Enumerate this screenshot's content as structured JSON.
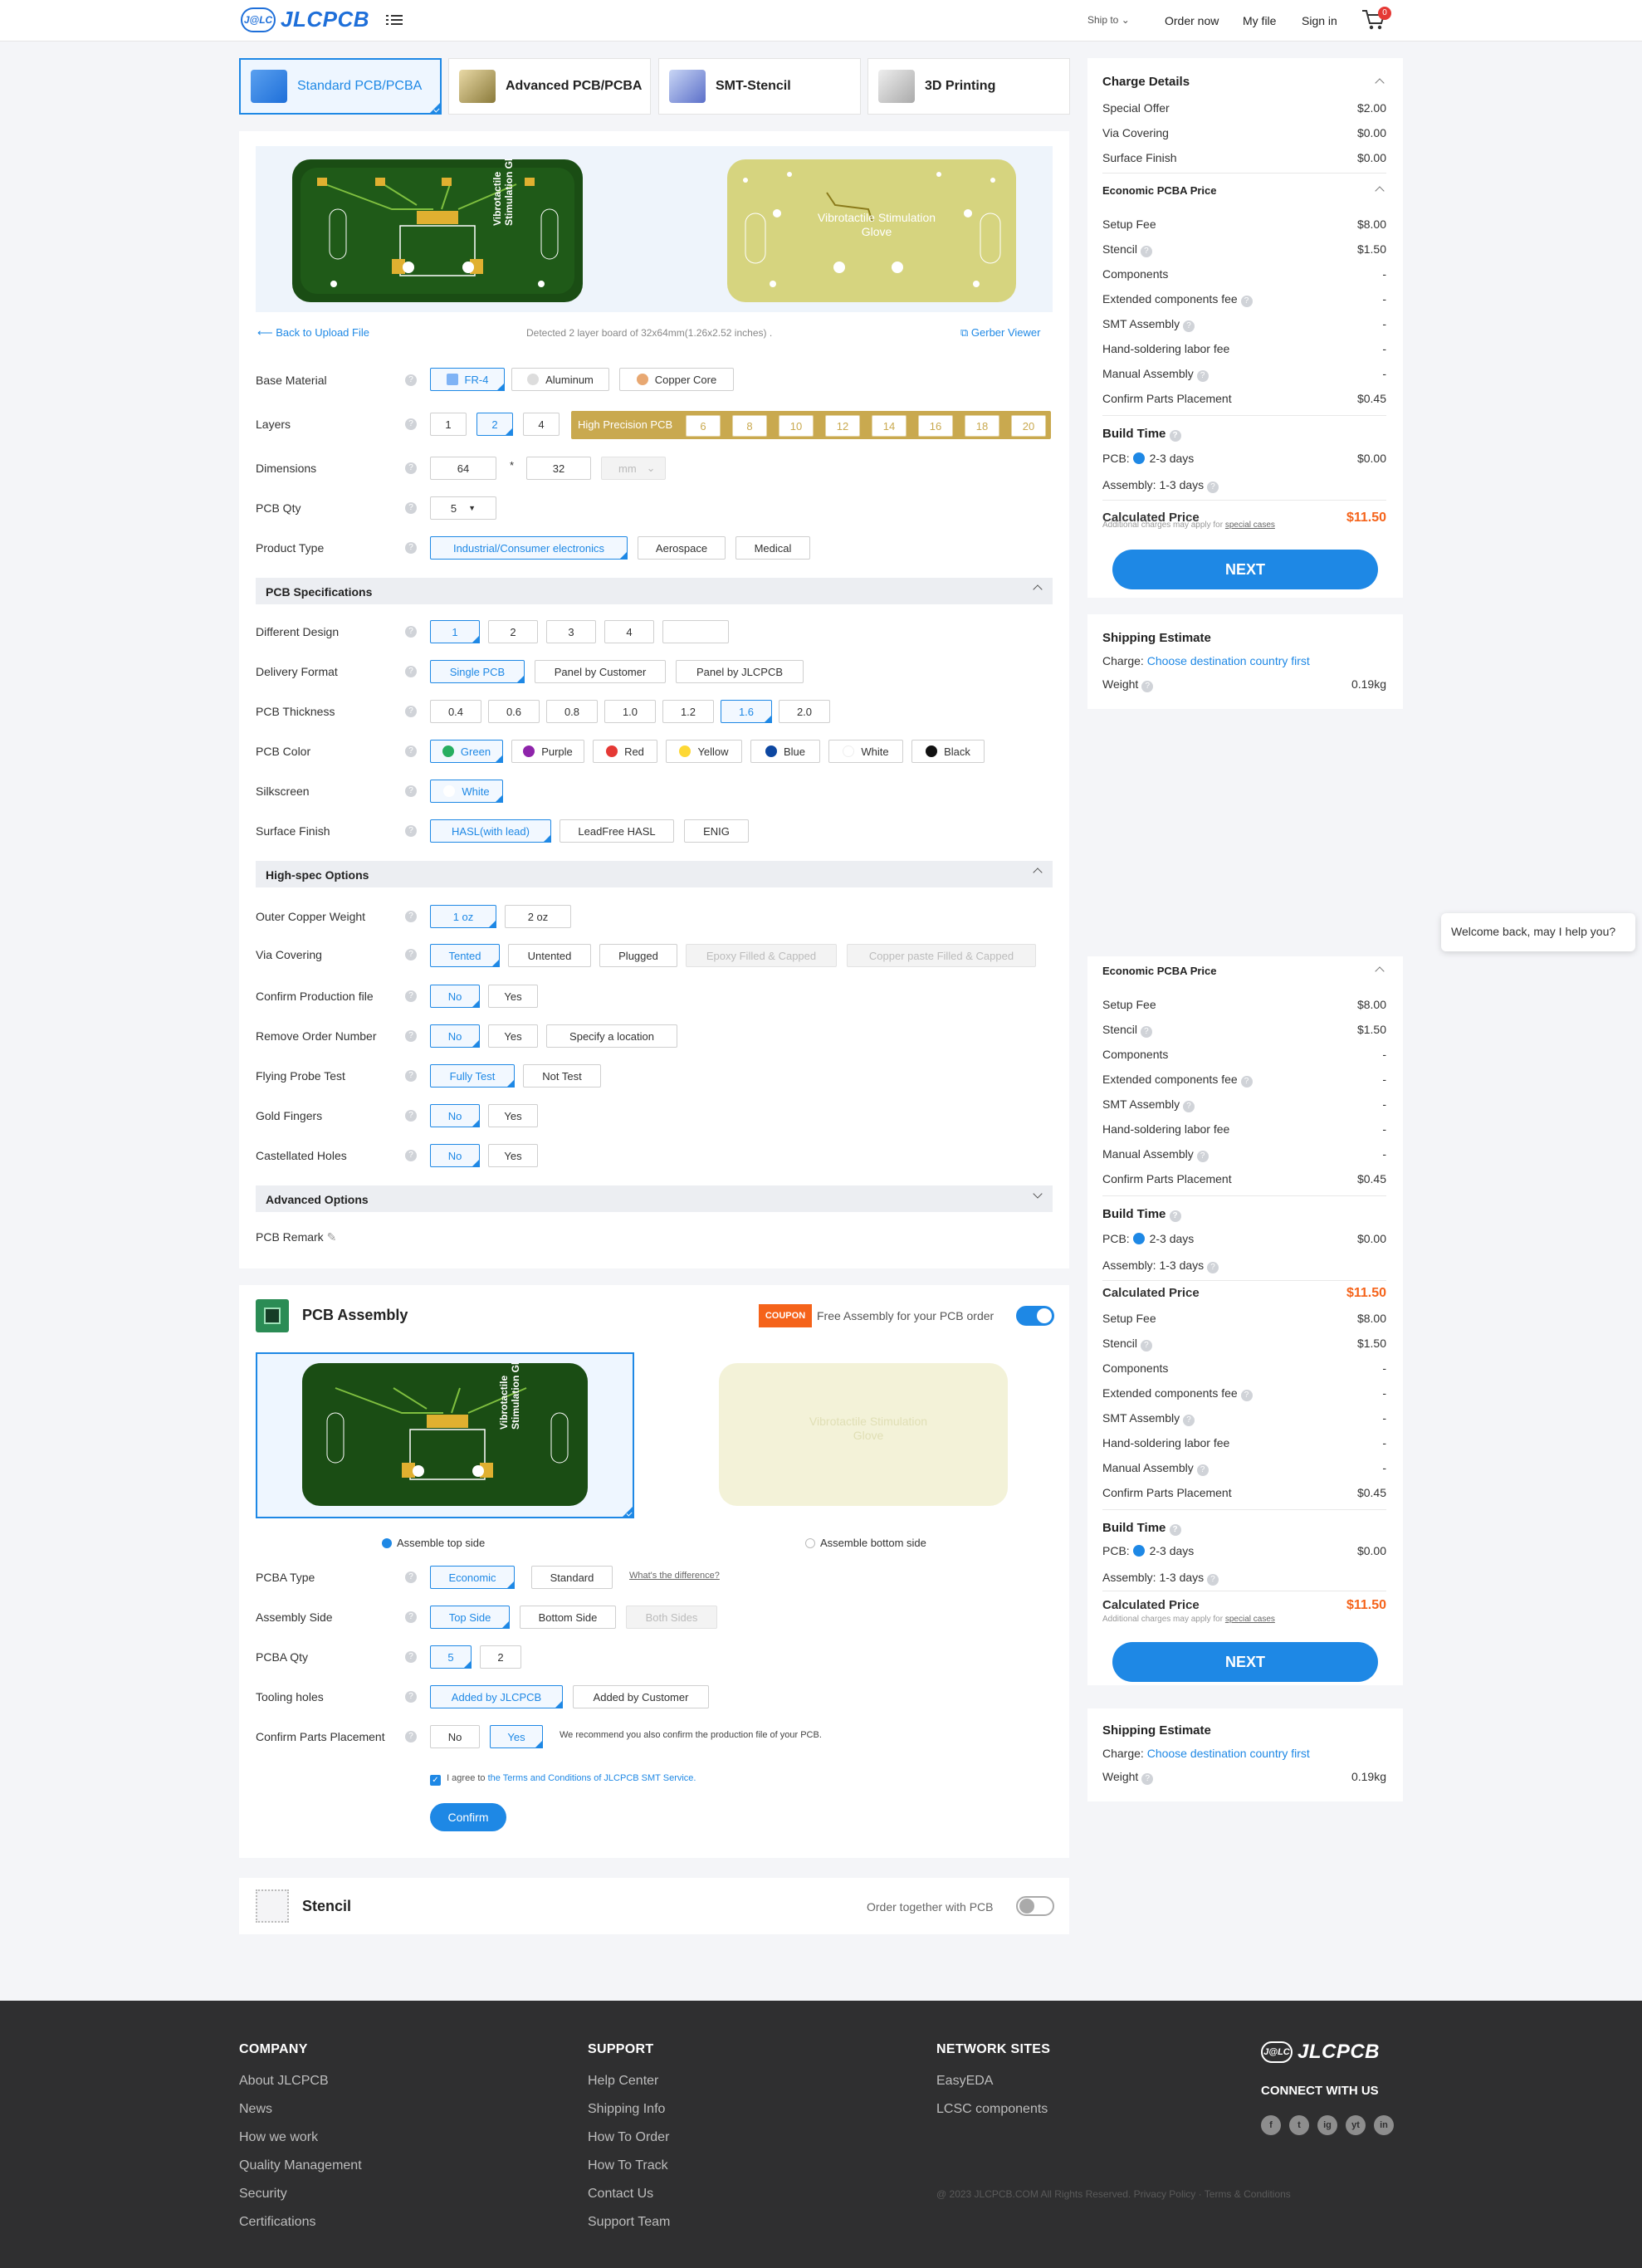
{
  "header": {
    "logo_badge": "J@LC",
    "logo_text": "JLCPCB",
    "ship_to": "Ship to",
    "order_now": "Order now",
    "my_file": "My file",
    "sign_in": "Sign in",
    "cart_count": "0"
  },
  "tabs": [
    {
      "label": "Standard PCB/PCBA"
    },
    {
      "label": "Advanced PCB/PCBA"
    },
    {
      "label": "SMT-Stencil"
    },
    {
      "label": "3D Printing"
    }
  ],
  "preview": {
    "board_text": "Vibrotactile Stimulation Glove",
    "back": "Back to Upload File",
    "detected": "Detected 2 layer board of 32x64mm(1.26x2.52 inches) .",
    "gerber": "Gerber Viewer"
  },
  "pcb": {
    "base_material": {
      "label": "Base Material",
      "options": [
        "FR-4",
        "Aluminum",
        "Copper Core"
      ]
    },
    "layers": {
      "label": "Layers",
      "options": [
        "1",
        "2",
        "4"
      ],
      "hp_label": "High Precision PCB",
      "hp_options": [
        "6",
        "8",
        "10",
        "12",
        "14",
        "16",
        "18",
        "20"
      ]
    },
    "dimensions": {
      "label": "Dimensions",
      "w": "64",
      "h": "32",
      "x": "*",
      "unit": "mm"
    },
    "qty": {
      "label": "PCB Qty",
      "value": "5"
    },
    "product_type": {
      "label": "Product Type",
      "options": [
        "Industrial/Consumer electronics",
        "Aerospace",
        "Medical"
      ]
    },
    "spec_title": "PCB Specifications",
    "diff_design": {
      "label": "Different Design",
      "options": [
        "1",
        "2",
        "3",
        "4"
      ]
    },
    "delivery": {
      "label": "Delivery Format",
      "options": [
        "Single PCB",
        "Panel by Customer",
        "Panel by JLCPCB"
      ]
    },
    "thickness": {
      "label": "PCB Thickness",
      "options": [
        "0.4",
        "0.6",
        "0.8",
        "1.0",
        "1.2",
        "1.6",
        "2.0"
      ]
    },
    "color": {
      "label": "PCB Color",
      "options": [
        "Green",
        "Purple",
        "Red",
        "Yellow",
        "Blue",
        "White",
        "Black"
      ],
      "swatches": [
        "#27ae60",
        "#8e24aa",
        "#e53935",
        "#fdd835",
        "#0d47a1",
        "#ffffff",
        "#111111"
      ]
    },
    "silkscreen": {
      "label": "Silkscreen",
      "value": "White"
    },
    "surface": {
      "label": "Surface Finish",
      "options": [
        "HASL(with lead)",
        "LeadFree HASL",
        "ENIG"
      ]
    },
    "highspec_title": "High-spec Options",
    "copper": {
      "label": "Outer Copper Weight",
      "options": [
        "1 oz",
        "2 oz"
      ]
    },
    "via": {
      "label": "Via Covering",
      "options": [
        "Tented",
        "Untented",
        "Plugged",
        "Epoxy Filled & Capped",
        "Copper paste Filled & Capped"
      ]
    },
    "confirm_prod": {
      "label": "Confirm Production file",
      "options": [
        "No",
        "Yes"
      ]
    },
    "remove_order": {
      "label": "Remove Order Number",
      "options": [
        "No",
        "Yes",
        "Specify a location"
      ]
    },
    "probe": {
      "label": "Flying Probe Test",
      "options": [
        "Fully Test",
        "Not Test"
      ]
    },
    "gold": {
      "label": "Gold Fingers",
      "options": [
        "No",
        "Yes"
      ]
    },
    "castellated": {
      "label": "Castellated Holes",
      "options": [
        "No",
        "Yes"
      ]
    },
    "advanced_title": "Advanced Options",
    "remark": "PCB Remark"
  },
  "assembly": {
    "title": "PCB Assembly",
    "coupon": "COUPON",
    "free_text": "Free Assembly for your PCB order",
    "top_side": "Assemble top side",
    "bottom_side": "Assemble bottom side",
    "pcba_type": {
      "label": "PCBA Type",
      "options": [
        "Economic",
        "Standard"
      ],
      "diff": "What's the difference?"
    },
    "side": {
      "label": "Assembly Side",
      "options": [
        "Top Side",
        "Bottom Side",
        "Both Sides"
      ]
    },
    "qty": {
      "label": "PCBA Qty",
      "options": [
        "5",
        "2"
      ]
    },
    "tooling": {
      "label": "Tooling holes",
      "options": [
        "Added by JLCPCB",
        "Added by Customer"
      ]
    },
    "confirm": {
      "label": "Confirm Parts Placement",
      "options": [
        "No",
        "Yes"
      ],
      "note": "We recommend you also confirm the production file of your PCB."
    },
    "agree": "I agree to",
    "terms": "the Terms and Conditions of JLCPCB SMT Service.",
    "confirm_btn": "Confirm"
  },
  "stencil": {
    "title": "Stencil",
    "together": "Order together with PCB"
  },
  "summary": {
    "charge_title": "Charge Details",
    "charges": [
      {
        "k": "Special Offer",
        "v": "$2.00"
      },
      {
        "k": "Via Covering",
        "v": "$0.00"
      },
      {
        "k": "Surface Finish",
        "v": "$0.00"
      }
    ],
    "pcba_title": "Economic PCBA Price",
    "pcba": [
      {
        "k": "Setup Fee",
        "v": "$8.00"
      },
      {
        "k": "Stencil",
        "v": "$1.50"
      },
      {
        "k": "Components",
        "v": "-"
      },
      {
        "k": "Extended components fee",
        "v": "-"
      },
      {
        "k": "SMT Assembly",
        "v": "-"
      },
      {
        "k": "Hand-soldering labor fee",
        "v": "-"
      },
      {
        "k": "Manual Assembly",
        "v": "-"
      },
      {
        "k": "Confirm Parts Placement",
        "v": "$0.45"
      }
    ],
    "build_title": "Build Time",
    "pcb_label": "PCB:",
    "pcb_days": "2-3 days",
    "pcb_cost": "$0.00",
    "asm_label": "Assembly:",
    "asm_days": "1-3 days",
    "calc_title": "Calculated Price",
    "calc_value": "$11.50",
    "note": "Additional charges may apply for",
    "special": "special cases",
    "next": "NEXT",
    "ship_title": "Shipping Estimate",
    "charge_label": "Charge:",
    "charge_link": "Choose destination country first",
    "weight_label": "Weight",
    "weight": "0.19kg"
  },
  "chat": "Welcome back, may I help you?",
  "footer": {
    "company_title": "COMPANY",
    "company": [
      "About JLCPCB",
      "News",
      "How we work",
      "Quality Management",
      "Security",
      "Certifications"
    ],
    "support_title": "SUPPORT",
    "support": [
      "Help Center",
      "Shipping Info",
      "How To Order",
      "How To Track",
      "Contact Us",
      "Support Team"
    ],
    "network_title": "NETWORK SITES",
    "network": [
      "EasyEDA",
      "LCSC components"
    ],
    "connect": "CONNECT WITH US",
    "social": [
      "f",
      "t",
      "ig",
      "yt",
      "in"
    ],
    "copyright": "@ 2023 JLCPCB.COM All Rights Reserved.",
    "privacy": "Privacy Policy",
    "terms": "Terms & Conditions"
  }
}
